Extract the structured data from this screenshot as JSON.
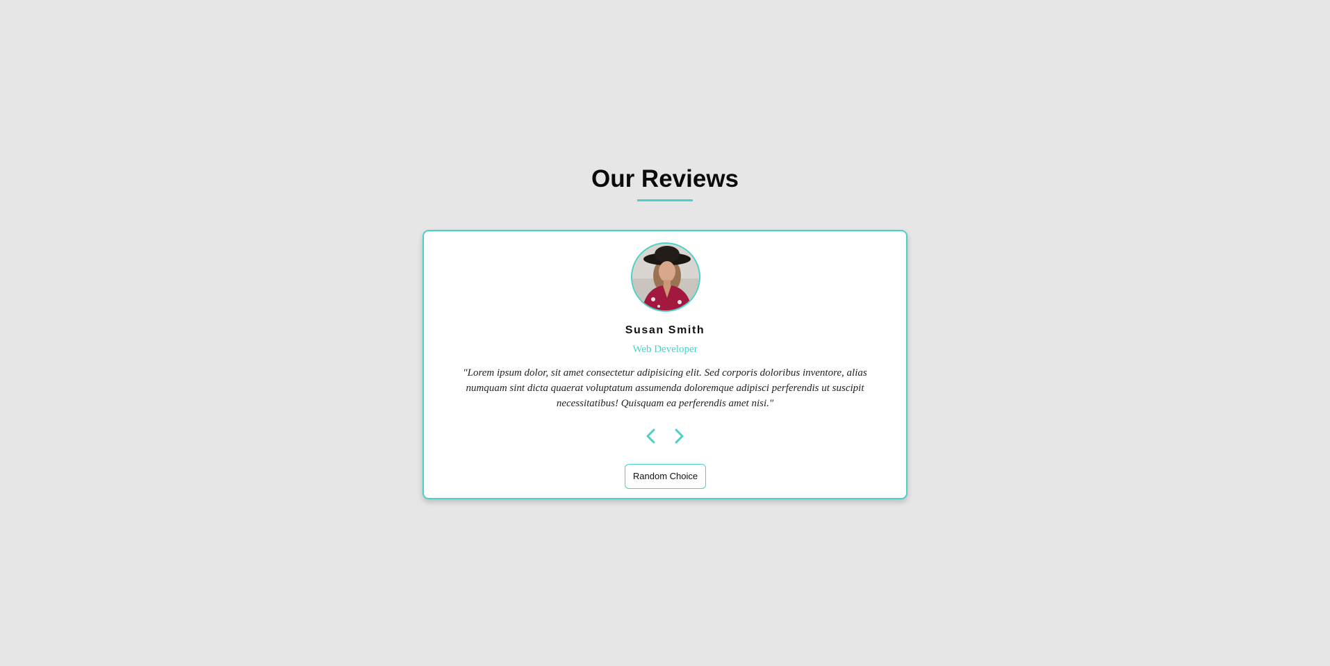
{
  "section": {
    "title": "Our Reviews"
  },
  "review": {
    "avatar_icon": "person-photo",
    "author": "Susan Smith",
    "job": "Web Developer",
    "text": "\"Lorem ipsum dolor, sit amet consectetur adipisicing elit. Sed corporis doloribus inventore, alias numquam sint dicta quaerat voluptatum assumenda doloremque adipisci perferendis ut suscipit necessitatibus! Quisquam ea perferendis amet nisi.\""
  },
  "controls": {
    "prev_icon": "chevron-left-icon",
    "next_icon": "chevron-right-icon",
    "random_label": "Random Choice"
  },
  "colors": {
    "accent": "#49d1c7",
    "background": "#e6e6e6",
    "card": "#ffffff"
  }
}
